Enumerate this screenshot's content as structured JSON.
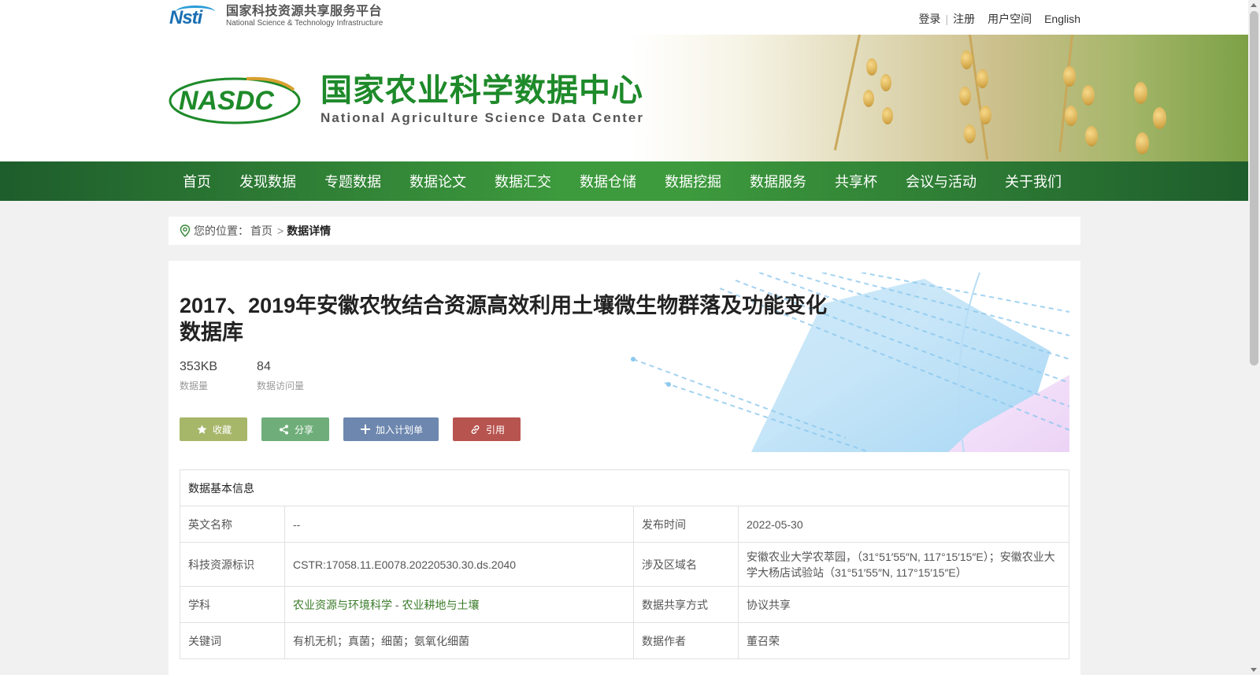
{
  "top": {
    "platform_cn": "国家科技资源共享服务平台",
    "platform_en": "National Science & Technology Infrastructure",
    "login": "登录",
    "register": "注册",
    "user_space": "用户空间",
    "english": "English"
  },
  "banner": {
    "title_cn": "国家农业科学数据中心",
    "title_en": "National Agriculture Science Data Center"
  },
  "nav": [
    "首页",
    "发现数据",
    "专题数据",
    "数据论文",
    "数据汇交",
    "数据仓储",
    "数据挖掘",
    "数据服务",
    "共享杯",
    "会议与活动",
    "关于我们"
  ],
  "breadcrumb": {
    "prefix": "您的位置：",
    "home": "首页",
    "separator": ">",
    "current": "数据详情"
  },
  "dataset": {
    "title": "2017、2019年安徽农牧结合资源高效利用土壤微生物群落及功能变化数据库",
    "size_value": "353KB",
    "size_label": "数据量",
    "visits_value": "84",
    "visits_label": "数据访问量"
  },
  "buttons": {
    "favorite": "收藏",
    "share": "分享",
    "add_plan": "加入计划单",
    "cite": "引用"
  },
  "info": {
    "header": "数据基本信息",
    "rows": [
      {
        "k1": "英文名称",
        "v1": "--",
        "k2": "发布时间",
        "v2": "2022-05-30"
      },
      {
        "k1": "科技资源标识",
        "v1": "CSTR:17058.11.E0078.20220530.30.ds.2040",
        "k2": "涉及区域名",
        "v2": "安徽农业大学农萃园，（31°51′55″N, 117°15′15″E）；安徽农业大学大杨店试验站（31°51′55″N, 117°15′15″E）"
      },
      {
        "k1": "学科",
        "subject_a": "农业资源与环境科学",
        "subject_sep": "-",
        "subject_b": "农业耕地与土壤",
        "k2": "数据共享方式",
        "v2": "协议共享"
      },
      {
        "k1": "关键词",
        "v1": "有机无机；真菌；细菌；氨氧化细菌",
        "k2": "数据作者",
        "v2": "董召荣"
      }
    ]
  },
  "colors": {
    "nav_dark": "#1e5d2c",
    "nav_light": "#3d9a3d",
    "title_green": "#1e8a2a",
    "btn_fav": "#a6b76a",
    "btn_share": "#6fae7a",
    "btn_plan": "#6d87ae",
    "btn_cite": "#b8544f"
  }
}
